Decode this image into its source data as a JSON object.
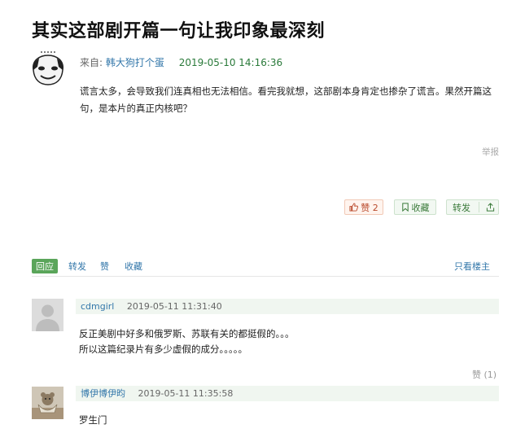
{
  "title": "其实这部剧开篇一句让我印象最深刻",
  "post": {
    "from_label": "来自:",
    "author": "韩大狗打个蛋",
    "datetime": "2019-05-10 14:16:36",
    "content": "谎言太多，会导致我们连真相也无法相信。看完我就想，这部剧本身肯定也掺杂了谎言。果然开篇这句，是本片的真正内核吧？",
    "report": "举报"
  },
  "actions": {
    "like": "赞 2",
    "collect": "收藏",
    "share": "转发"
  },
  "reply_tabs": {
    "reply": "回应",
    "forward": "转发",
    "like": "赞",
    "collect": "收藏",
    "owner_only": "只看楼主"
  },
  "comments": [
    {
      "user": "cdmgirl",
      "time": "2019-05-11 11:31:40",
      "lines": [
        "反正美剧中好多和俄罗斯、苏联有关的都挺假的。。。",
        "所以这篇纪录片有多少虚假的成分。。。。。"
      ],
      "vote": "赞 (1)"
    },
    {
      "user": "博伊博伊昀",
      "time": "2019-05-11 11:35:58",
      "lines": [
        "罗生门"
      ]
    }
  ],
  "colors": {
    "link_blue": "#3377aa",
    "date_green": "#2a7a3a",
    "reply_tab_green": "#5aa55a"
  },
  "icons": {
    "like": "thumbs-up-icon",
    "collect": "bookmark-icon",
    "share": "share-upload-icon"
  }
}
